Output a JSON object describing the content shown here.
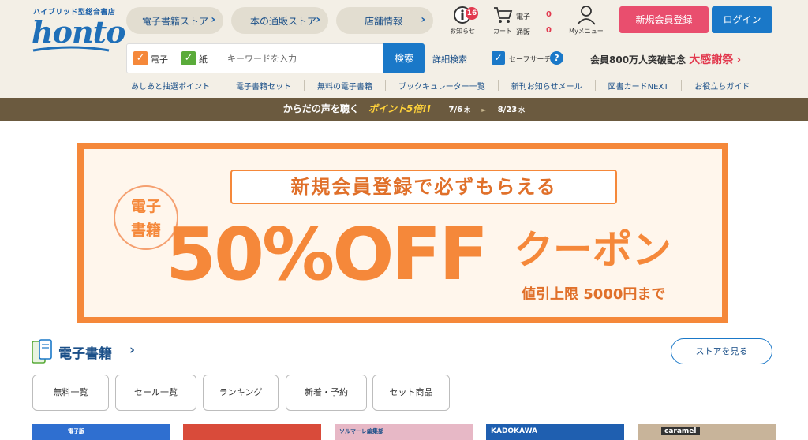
{
  "brand": {
    "tagline": "ハイブリッド型総合書店",
    "logo": "honto"
  },
  "nav": {
    "pills": [
      {
        "label": "電子書籍ストア"
      },
      {
        "label": "本の通販ストア"
      },
      {
        "label": "店舗情報"
      }
    ],
    "notice": {
      "label": "お知らせ",
      "count": "16"
    },
    "cart": {
      "label": "カート",
      "ebook_label": "電子",
      "ebook_count": "0",
      "print_label": "通販",
      "print_count": "0"
    },
    "mymenu": {
      "label": "Myメニュー"
    },
    "register": "新規会員登録",
    "login": "ログイン"
  },
  "search": {
    "check_ebook": "電子",
    "check_paper": "紙",
    "placeholder": "キーワードを入力",
    "button": "検索",
    "advanced": "詳細検索",
    "safe": "セーフサーチ",
    "help": "?"
  },
  "promo": {
    "prefix": "会員800万人突破記念",
    "highlight": "大感謝祭",
    "chevron": "›"
  },
  "sublinks": [
    "あしあと抽選ポイント",
    "電子書籍セット",
    "無料の電子書籍",
    "ブックキュレーター一覧",
    "新刊お知らせメール",
    "図書カードNEXT",
    "お役立ちガイド"
  ],
  "strip": {
    "text": "からだの声を聴く",
    "highlight": "ポイント5倍!!",
    "date_from": "7/6",
    "day_from": "木",
    "arrow": "►",
    "date_to": "8/23",
    "day_to": "水"
  },
  "hero": {
    "ribbon": "新規会員登録で必ずもらえる",
    "circle_line1": "電子",
    "circle_line2": "書籍",
    "big": "50%OFF",
    "coupon": "クーポン",
    "limit": "値引上限 5000円まで"
  },
  "section": {
    "title": "電子書籍",
    "store_button": "ストアを見る",
    "tabs": [
      "無料一覧",
      "セール一覧",
      "ランキング",
      "新着・予約",
      "セット商品"
    ]
  },
  "thumbs": {
    "labels": [
      "電子版",
      "ソルマーレ編集部",
      "KADOKAWA",
      "caramel"
    ]
  },
  "colors": {
    "accent": "#1a78c8",
    "register": "#e94e6e",
    "hero": "#f5883a",
    "strip": "#6b5a3f"
  }
}
